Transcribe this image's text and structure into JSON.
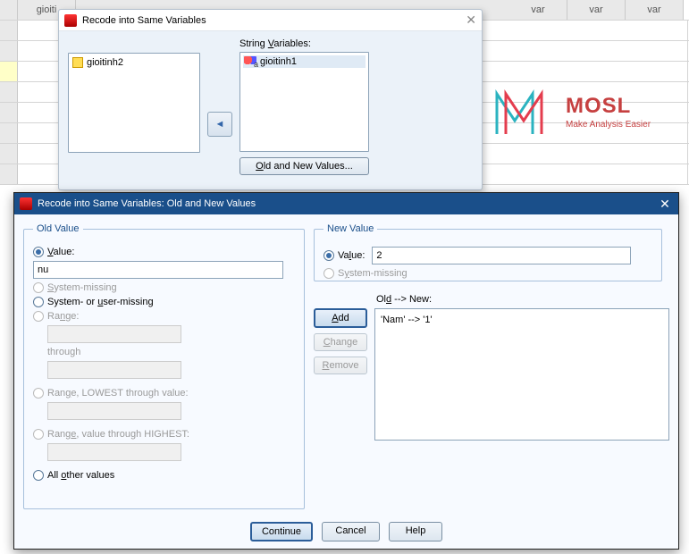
{
  "grid": {
    "col1": "gioiti",
    "varLabel": "var"
  },
  "dialog1": {
    "title": "Recode into Same Variables",
    "leftItem": "gioitinh2",
    "rightLabel": "String Variables:",
    "rightItem": "gioitinh1",
    "oldNewBtn": "Old and New Values..."
  },
  "logo": {
    "big": "MOSL",
    "small": "Make Analysis Easier"
  },
  "dialog2": {
    "title": "Recode into Same Variables: Old and New Values",
    "oldLegend": "Old Value",
    "newLegend": "New Value",
    "value": "Value:",
    "oldValueInput": "nu",
    "newValueInput": "2",
    "sysMissing": "System-missing",
    "sysUserMissing": "System- or user-missing",
    "range": "Range:",
    "through": "through",
    "rangeLowest": "Range, LOWEST through value:",
    "rangeHighest": "Range, value through HIGHEST:",
    "allOther": "All other values",
    "oldNewLabel": "Old --> New:",
    "mapping1": "'Nam' --> '1'",
    "add": "Add",
    "change": "Change",
    "remove": "Remove",
    "continue": "Continue",
    "cancel": "Cancel",
    "help": "Help"
  }
}
